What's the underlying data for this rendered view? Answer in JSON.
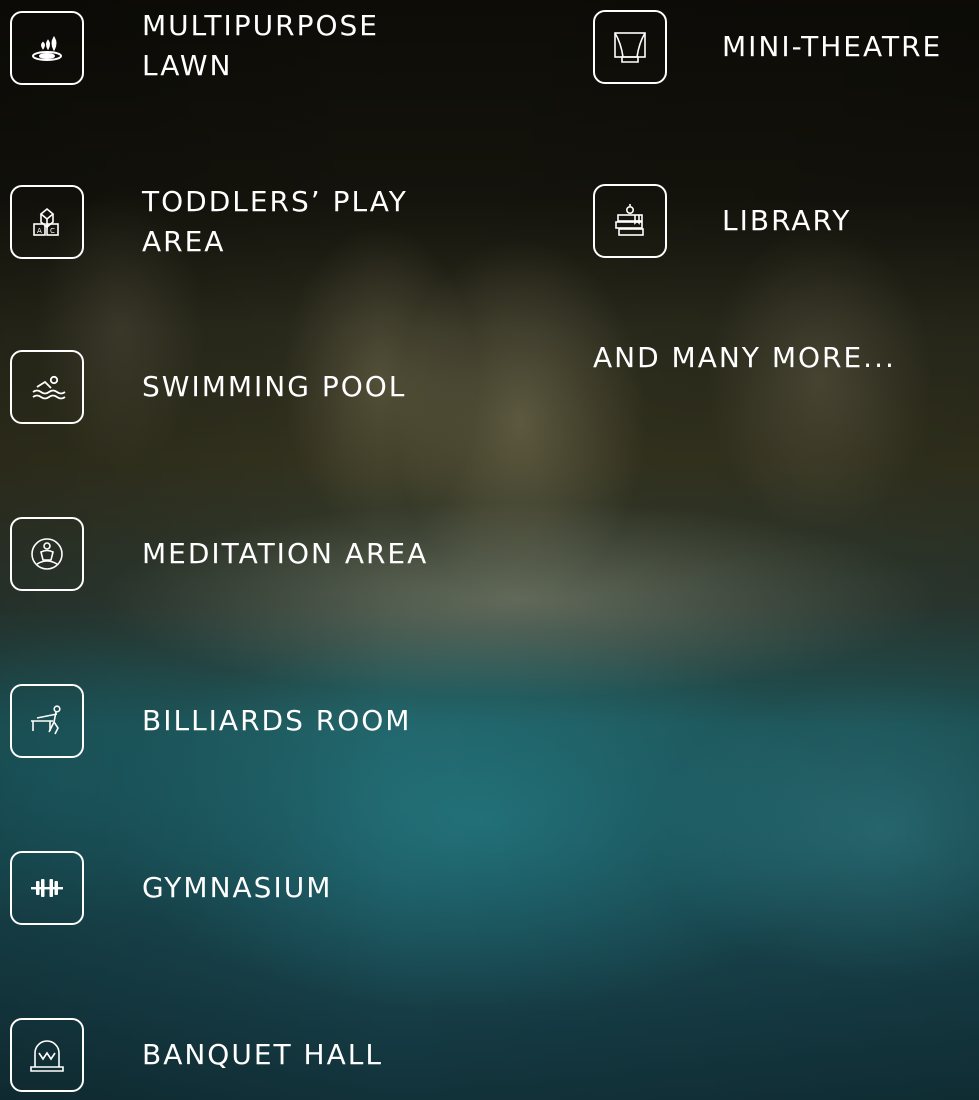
{
  "amenities_left": [
    {
      "label": "MULTIPURPOSE LAWN",
      "icon": "lawn-sprinkler-icon"
    },
    {
      "label": "TODDLERS’ PLAY AREA",
      "icon": "toy-blocks-icon"
    },
    {
      "label": "SWIMMING POOL",
      "icon": "swimmer-icon"
    },
    {
      "label": "MEDITATION AREA",
      "icon": "meditation-icon"
    },
    {
      "label": "BILLIARDS ROOM",
      "icon": "billiards-icon"
    },
    {
      "label": "GYMNASIUM",
      "icon": "dumbbell-icon"
    },
    {
      "label": "BANQUET HALL",
      "icon": "banquet-arch-icon"
    }
  ],
  "amenities_right": [
    {
      "label": "MINI-THEATRE",
      "icon": "theatre-stage-icon"
    },
    {
      "label": "LIBRARY",
      "icon": "books-icon"
    }
  ],
  "more_text": "AND MANY MORE..."
}
